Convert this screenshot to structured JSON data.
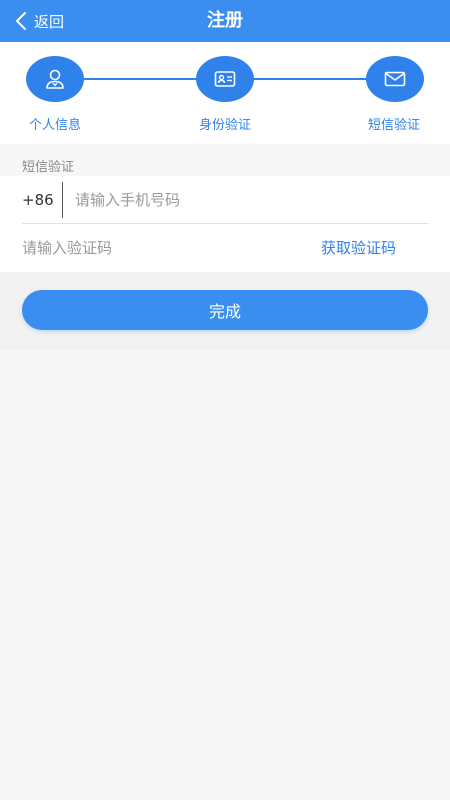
{
  "header": {
    "back_label": "返回",
    "title": "注册"
  },
  "steps": [
    {
      "label": "个人信息",
      "icon": "user-icon"
    },
    {
      "label": "身份验证",
      "icon": "id-card-icon"
    },
    {
      "label": "短信验证",
      "icon": "mail-icon"
    }
  ],
  "form": {
    "section_title": "短信验证",
    "phone_prefix": "+86",
    "phone_placeholder": "请输入手机号码",
    "phone_value": "",
    "code_placeholder": "请输入验证码",
    "code_value": "",
    "get_code_label": "获取验证码"
  },
  "submit": {
    "label": "完成"
  },
  "colors": {
    "header": "#3a8ef0",
    "accent": "#2f82ec"
  }
}
